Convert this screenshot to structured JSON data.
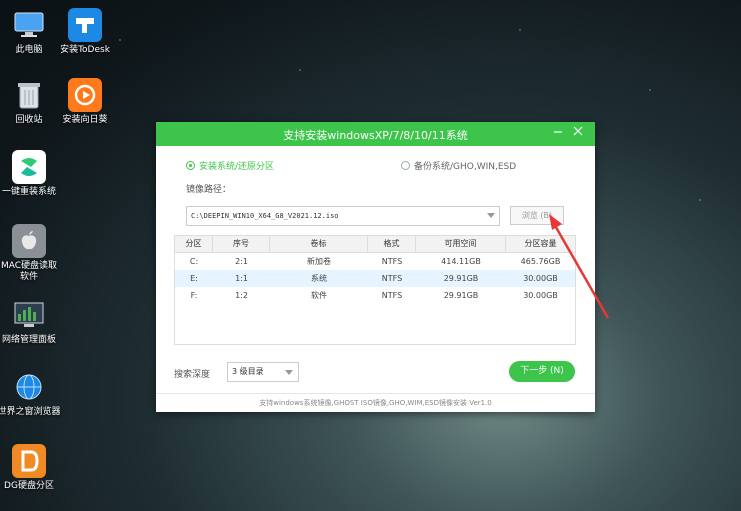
{
  "desktop": {
    "icons": [
      {
        "label": "此电脑",
        "icon": "computer-icon"
      },
      {
        "label": "安装ToDesk",
        "icon": "todesk-icon"
      },
      {
        "label": "回收站",
        "icon": "recycle-bin-icon"
      },
      {
        "label": "安装向日葵",
        "icon": "sunflower-icon"
      },
      {
        "label": "一键重装系统",
        "icon": "reinstall-icon"
      },
      {
        "label": "MAC硬盘读取软件",
        "icon": "mac-icon"
      },
      {
        "label": "网络管理面板",
        "icon": "network-panel-icon"
      },
      {
        "label": "世界之窗浏览器",
        "icon": "browser-globe-icon"
      },
      {
        "label": "DG硬盘分区",
        "icon": "diskgenius-icon"
      }
    ]
  },
  "window": {
    "title": "支持安装windowsXP/7/8/10/11系统",
    "options": {
      "install_label": "安装系统/还原分区",
      "backup_label": "备份系统/GHO,WIN,ESD"
    },
    "path_label": "镜像路径：",
    "path_value": "C:\\DEEPIN_WIN10_X64_G8_V2021.12.iso",
    "browse_label": "浏览 (B)",
    "table": {
      "headers": [
        "分区",
        "序号",
        "卷标",
        "格式",
        "可用空间",
        "分区容量"
      ],
      "rows": [
        [
          "C:",
          "2:1",
          "新加卷",
          "NTFS",
          "414.11GB",
          "465.76GB"
        ],
        [
          "E:",
          "1:1",
          "系统",
          "NTFS",
          "29.91GB",
          "30.00GB"
        ],
        [
          "F:",
          "1:2",
          "软件",
          "NTFS",
          "29.91GB",
          "30.00GB"
        ]
      ]
    },
    "depth_label": "搜索深度",
    "depth_value": "3 级目录",
    "next_label": "下一步 (N)",
    "footer": "支持windows系统镜像,GHOST ISO镜像,GHO,WIM,ESD镜像安装 Ver1.0"
  },
  "colors": {
    "accent": "#3cc54a",
    "arrow": "#e53935"
  }
}
